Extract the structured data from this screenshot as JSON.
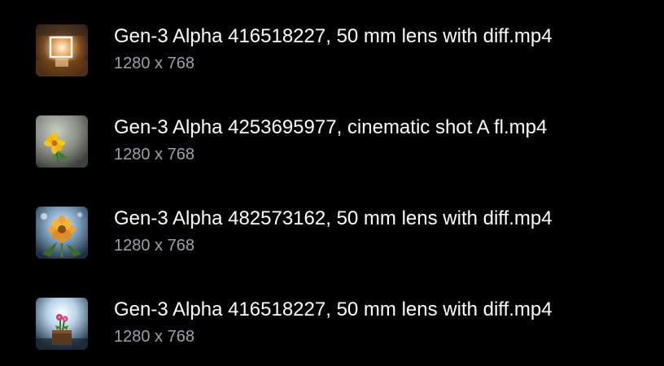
{
  "files": [
    {
      "name": "Gen-3 Alpha 416518227, 50 mm lens with diff.mp4",
      "dimensions": "1280 x 768",
      "thumbnail_icon": "video-thumbnail-glowing-box"
    },
    {
      "name": "Gen-3 Alpha 4253695977, cinematic shot A fl.mp4",
      "dimensions": "1280 x 768",
      "thumbnail_icon": "video-thumbnail-yellow-flower"
    },
    {
      "name": "Gen-3 Alpha 482573162, 50 mm lens with diff.mp4",
      "dimensions": "1280 x 768",
      "thumbnail_icon": "video-thumbnail-orange-flower"
    },
    {
      "name": "Gen-3 Alpha 416518227, 50 mm lens with diff.mp4",
      "dimensions": "1280 x 768",
      "thumbnail_icon": "video-thumbnail-potted-flower"
    }
  ],
  "colors": {
    "background": "#000000",
    "name_text": "#ffffff",
    "dims_text": "#9aa1ab"
  }
}
